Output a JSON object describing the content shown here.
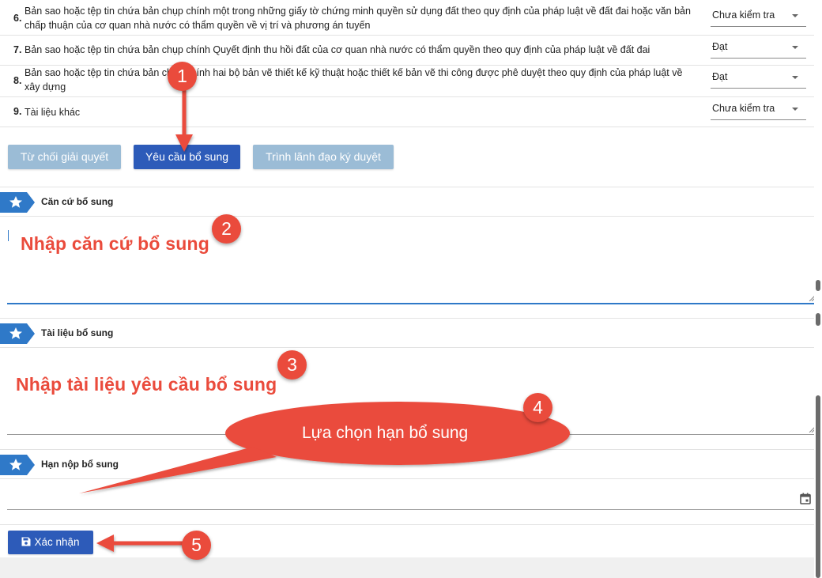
{
  "documents": [
    {
      "num": "6.",
      "text": "Bản sao hoặc tệp tin chứa bản chụp chính một trong những giấy tờ chứng minh quyền sử dụng đất theo quy định của pháp luật về đất đai hoặc văn bản chấp thuận của cơ quan nhà nước có thẩm quyền về vị trí và phương án tuyến",
      "status": "Chưa kiểm tra"
    },
    {
      "num": "7.",
      "text": "Bản sao hoặc tệp tin chứa bản chụp chính Quyết định thu hồi đất của cơ quan nhà nước có thẩm quyền theo quy định của pháp luật về đất đai",
      "status": "Đạt"
    },
    {
      "num": "8.",
      "text": "Bản sao hoặc tệp tin chứa bản chụp chính hai bộ bản vẽ thiết kế kỹ thuật hoặc thiết kế bản vẽ thi công được phê duyệt theo quy định của pháp luật về xây dựng",
      "status": "Đạt"
    },
    {
      "num": "9.",
      "text": "Tài liệu khác",
      "status": "Chưa kiểm tra"
    }
  ],
  "actions": {
    "reject": "Từ chối giải quyết",
    "request_supplement": "Yêu cầu bổ sung",
    "submit_leader": "Trình lãnh đạo ký duyệt"
  },
  "sections": {
    "basis": "Căn cứ bổ sung",
    "documents": "Tài liệu bổ sung",
    "deadline": "Hạn nộp bổ sung"
  },
  "confirm_label": "Xác nhận",
  "annotations": {
    "step1": "1",
    "step2": "2",
    "step3": "3",
    "step4": "4",
    "step5": "5",
    "hint_basis": "Nhập căn cứ bổ sung",
    "hint_documents": "Nhập tài liệu yêu cầu bổ sung",
    "hint_deadline": "Lựa chọn hạn bổ sung"
  },
  "colors": {
    "primary": "#2d5bb9",
    "primary_disabled": "#9bbcd6",
    "section_tag": "#2f79c8",
    "annotation_red": "#ea4b3c",
    "input_focus": "#2f79c8"
  },
  "icons": {
    "section_tag": "star-icon",
    "calendar": "calendar-icon",
    "save": "save-icon",
    "dropdown": "caret-down-icon"
  }
}
